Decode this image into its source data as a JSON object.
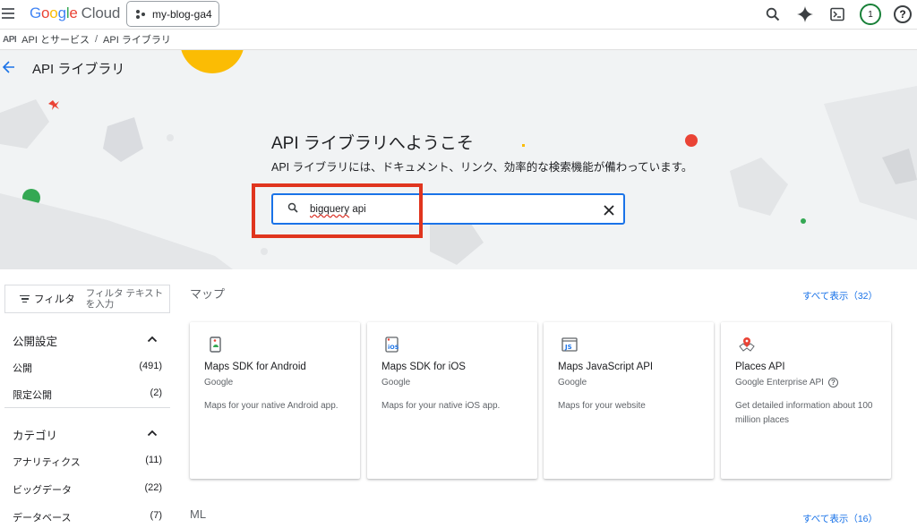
{
  "header": {
    "logo_parts": [
      "G",
      "o",
      "o",
      "g",
      "l",
      "e"
    ],
    "logo_cloud": "Cloud",
    "project": "my-blog-ga4",
    "avatar": "1",
    "help": "?"
  },
  "breadcrumb": {
    "icon_text": "API",
    "items": [
      "API とサービス",
      "API ライブラリ"
    ],
    "separator": "/"
  },
  "page": {
    "title": "API ライブラリ"
  },
  "hero": {
    "title": "API ライブラリへようこそ",
    "subtitle": "API ライブラリには、ドキュメント、リンク、効率的な検索機能が備わっています。",
    "search_value_underlined": "bigquery",
    "search_value_rest": " api"
  },
  "sidebar": {
    "filter_label": "フィルタ",
    "filter_placeholder": "フィルタ テキストを入力",
    "groups": [
      {
        "title": "公開設定",
        "items": [
          {
            "label": "公開",
            "count": "(491)"
          },
          {
            "label": "限定公開",
            "count": "(2)"
          }
        ]
      },
      {
        "title": "カテゴリ",
        "items": [
          {
            "label": "アナリティクス",
            "count": "(11)"
          },
          {
            "label": "ビッグデータ",
            "count": "(22)"
          },
          {
            "label": "データベース",
            "count": "(7)"
          }
        ]
      }
    ]
  },
  "sections": [
    {
      "title": "マップ",
      "show_all": "すべて表示（32）"
    },
    {
      "title": "ML",
      "show_all": "すべて表示（16）"
    }
  ],
  "cards": [
    {
      "name": "Maps SDK for Android",
      "publisher": "Google",
      "description": "Maps for your native Android app.",
      "icon": "android-maps-icon"
    },
    {
      "name": "Maps SDK for iOS",
      "publisher": "Google",
      "description": "Maps for your native iOS app.",
      "icon_text": "iOS",
      "icon": "ios-maps-icon"
    },
    {
      "name": "Maps JavaScript API",
      "publisher": "Google",
      "description": "Maps for your website",
      "icon_text": "JS",
      "icon": "js-maps-icon"
    },
    {
      "name": "Places API",
      "publisher": "Google Enterprise API",
      "description": "Get detailed information about 100 million places",
      "icon": "places-pin-icon"
    }
  ],
  "colors": {
    "accent": "#1a73e8",
    "highlight": "#e0351e"
  }
}
